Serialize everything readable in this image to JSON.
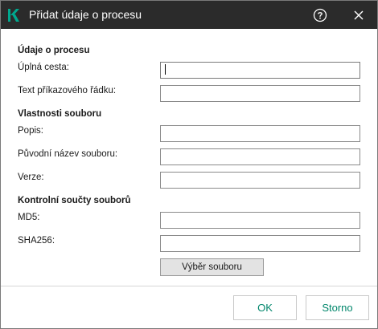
{
  "dialog": {
    "title": "Přidat údaje o procesu",
    "logo_icon": "kaspersky-k-logo",
    "help_icon": "help-circle-icon",
    "close_icon": "close-x-icon",
    "accent_color": "#00a88e"
  },
  "process_section": {
    "heading": "Údaje o procesu",
    "full_path_label": "Úplná cesta:",
    "full_path_value": "",
    "command_line_label": "Text příkazového řádku:",
    "command_line_value": ""
  },
  "file_properties_section": {
    "heading": "Vlastnosti souboru",
    "description_label": "Popis:",
    "description_value": "",
    "original_name_label": "Původní název souboru:",
    "original_name_value": "",
    "version_label": "Verze:",
    "version_value": ""
  },
  "checksums_section": {
    "heading": "Kontrolní součty souborů",
    "md5_label": "MD5:",
    "md5_value": "",
    "sha256_label": "SHA256:",
    "sha256_value": "",
    "select_file_label": "Výběr souboru"
  },
  "footer": {
    "ok_label": "OK",
    "cancel_label": "Storno",
    "button_text_color": "#00866b"
  }
}
